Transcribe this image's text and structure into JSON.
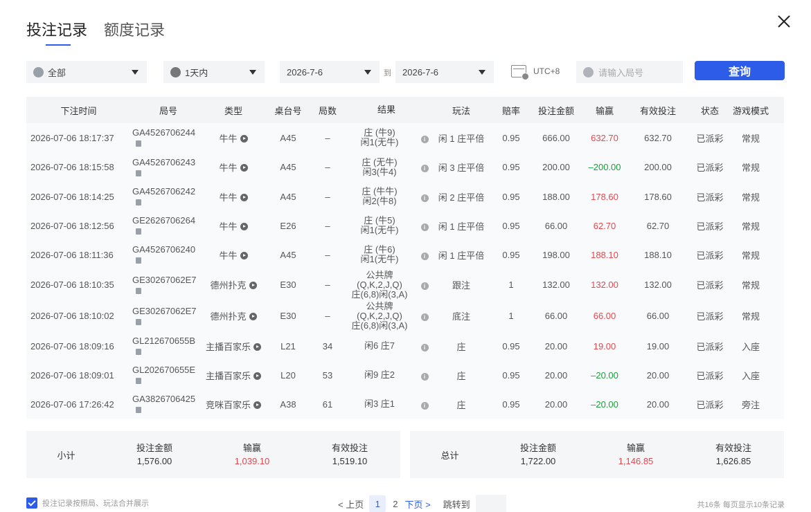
{
  "tabs": [
    "投注记录",
    "额度记录"
  ],
  "filters": {
    "category": "全部",
    "period": "1天内",
    "date_from": "2026-7-6",
    "to_label": "到",
    "date_to": "2026-7-6",
    "timezone": "UTC+8",
    "search_placeholder": "请输入局号",
    "query_button": "查询"
  },
  "table": {
    "columns": [
      "下注时间",
      "局号",
      "类型",
      "桌台号",
      "局数",
      "结果",
      "玩法",
      "赔率",
      "投注金额",
      "输赢",
      "有效投注",
      "状态",
      "游戏模式"
    ],
    "rows": [
      {
        "time": "2026-07-06 18:17:37",
        "id": "GA4526706244",
        "type": "牛牛",
        "table": "A45",
        "round": "–",
        "result": [
          "庄 (牛9)",
          "闲1(无牛)"
        ],
        "play": "闲 1 庄平倍",
        "odds": "0.95",
        "bet": "666.00",
        "win": "632.70",
        "win_sign": "pos",
        "valid": "632.70",
        "status": "已派彩",
        "mode": "常规"
      },
      {
        "time": "2026-07-06 18:15:58",
        "id": "GA4526706243",
        "type": "牛牛",
        "table": "A45",
        "round": "–",
        "result": [
          "庄 (无牛)",
          "闲3(牛4)"
        ],
        "play": "闲 3 庄平倍",
        "odds": "0.95",
        "bet": "200.00",
        "win": "–200.00",
        "win_sign": "neg",
        "valid": "200.00",
        "status": "已派彩",
        "mode": "常规"
      },
      {
        "time": "2026-07-06 18:14:25",
        "id": "GA4526706242",
        "type": "牛牛",
        "table": "A45",
        "round": "–",
        "result": [
          "庄 (牛牛)",
          "闲2(牛8)"
        ],
        "play": "闲 2 庄平倍",
        "odds": "0.95",
        "bet": "188.00",
        "win": "178.60",
        "win_sign": "pos",
        "valid": "178.60",
        "status": "已派彩",
        "mode": "常规"
      },
      {
        "time": "2026-07-06 18:12:56",
        "id": "GE2626706264",
        "type": "牛牛",
        "table": "E26",
        "round": "–",
        "result": [
          "庄 (牛5)",
          "闲1(无牛)"
        ],
        "play": "闲 1 庄平倍",
        "odds": "0.95",
        "bet": "66.00",
        "win": "62.70",
        "win_sign": "pos",
        "valid": "62.70",
        "status": "已派彩",
        "mode": "常规"
      },
      {
        "time": "2026-07-06 18:11:36",
        "id": "GA4526706240",
        "type": "牛牛",
        "table": "A45",
        "round": "–",
        "result": [
          "庄 (牛6)",
          "闲1(无牛)"
        ],
        "play": "闲 1 庄平倍",
        "odds": "0.95",
        "bet": "198.00",
        "win": "188.10",
        "win_sign": "pos",
        "valid": "188.10",
        "status": "已派彩",
        "mode": "常规"
      },
      {
        "time": "2026-07-06 18:10:35",
        "id": "GE30267062E7",
        "type": "德州扑克",
        "table": "E30",
        "round": "–",
        "result": [
          "公共牌",
          "(Q,K,2,J,Q)",
          "庄(6,8)闲(3,A)"
        ],
        "play": "跟注",
        "odds": "1",
        "bet": "132.00",
        "win": "132.00",
        "win_sign": "pos",
        "valid": "132.00",
        "status": "已派彩",
        "mode": "常规"
      },
      {
        "time": "2026-07-06 18:10:02",
        "id": "GE30267062E7",
        "type": "德州扑克",
        "table": "E30",
        "round": "–",
        "result": [
          "公共牌",
          "(Q,K,2,J,Q)",
          "庄(6,8)闲(3,A)"
        ],
        "play": "底注",
        "odds": "1",
        "bet": "66.00",
        "win": "66.00",
        "win_sign": "pos",
        "valid": "66.00",
        "status": "已派彩",
        "mode": "常规"
      },
      {
        "time": "2026-07-06 18:09:16",
        "id": "GL212670655B",
        "type": "主播百家乐",
        "table": "L21",
        "round": "34",
        "result": [
          "闲6 庄7"
        ],
        "play": "庄",
        "odds": "0.95",
        "bet": "20.00",
        "win": "19.00",
        "win_sign": "pos",
        "valid": "19.00",
        "status": "已派彩",
        "mode": "入座"
      },
      {
        "time": "2026-07-06 18:09:01",
        "id": "GL202670655E",
        "type": "主播百家乐",
        "table": "L20",
        "round": "53",
        "result": [
          "闲9 庄2"
        ],
        "play": "庄",
        "odds": "0.95",
        "bet": "20.00",
        "win": "–20.00",
        "win_sign": "neg",
        "valid": "20.00",
        "status": "已派彩",
        "mode": "入座"
      },
      {
        "time": "2026-07-06 17:26:42",
        "id": "GA3826706425",
        "type": "竞咪百家乐",
        "table": "A38",
        "round": "61",
        "result": [
          "闲3 庄1"
        ],
        "play": "庄",
        "odds": "0.95",
        "bet": "20.00",
        "win": "–20.00",
        "win_sign": "neg",
        "valid": "20.00",
        "status": "已派彩",
        "mode": "旁注"
      }
    ]
  },
  "subtotal": {
    "label": "小计",
    "bet_label": "投注金额",
    "bet": "1,576.00",
    "win_label": "输赢",
    "win": "1,039.10",
    "valid_label": "有效投注",
    "valid": "1,519.10"
  },
  "total": {
    "label": "总计",
    "bet_label": "投注金额",
    "bet": "1,722.00",
    "win_label": "输赢",
    "win": "1,146.85",
    "valid_label": "有效投注",
    "valid": "1,626.85"
  },
  "footer": {
    "merge_checkbox": "投注记录按照局、玩法合并展示",
    "prev": "< 上页",
    "pages": [
      "1",
      "2"
    ],
    "current_page": "1",
    "next": "下页 >",
    "jump_label": "跳转到",
    "summary": "共16条  每页显示10条记录"
  },
  "colors": {
    "accent": "#2d5ce8",
    "win": "#e5484d",
    "loss": "#1a9e3a"
  },
  "icons": [
    "close-icon",
    "clock-icon",
    "calendar-icon",
    "copy-icon",
    "play-icon",
    "info-icon",
    "check-icon"
  ]
}
